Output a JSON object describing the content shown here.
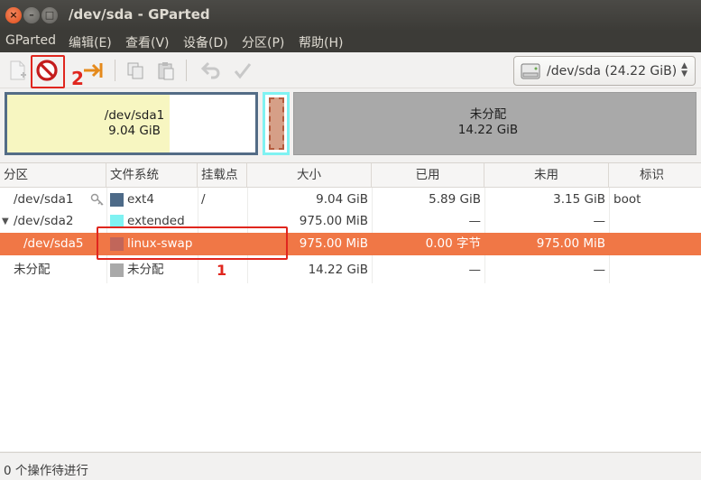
{
  "window": {
    "title": "/dev/sda - GParted"
  },
  "menu": [
    "GParted",
    "编辑(E)",
    "查看(V)",
    "设备(D)",
    "分区(P)",
    "帮助(H)"
  ],
  "toolbar": {
    "device_select": "/dev/sda  (24.22 GiB)",
    "annotation_toolbar": "2"
  },
  "diskmap": {
    "sda1": {
      "name": "/dev/sda1",
      "size": "9.04 GiB"
    },
    "unallocated": {
      "name": "未分配",
      "size": "14.22 GiB"
    }
  },
  "table": {
    "headers": [
      "分区",
      "文件系统",
      "挂载点",
      "大小",
      "已用",
      "未用",
      "标识"
    ],
    "rows": [
      {
        "partition": "/dev/sda1",
        "fs": "ext4",
        "mount": "/",
        "size": "9.04 GiB",
        "used": "5.89 GiB",
        "unused": "3.15 GiB",
        "flags": "boot"
      },
      {
        "partition": "/dev/sda2",
        "fs": "extended",
        "mount": "",
        "size": "975.00 MiB",
        "used": "—",
        "unused": "—",
        "flags": ""
      },
      {
        "partition": "/dev/sda5",
        "fs": "linux-swap",
        "mount": "",
        "size": "975.00 MiB",
        "used": "0.00 字节",
        "unused": "975.00 MiB",
        "flags": ""
      },
      {
        "partition": "未分配",
        "fs": "未分配",
        "mount": "",
        "size": "14.22 GiB",
        "used": "—",
        "unused": "—",
        "flags": ""
      }
    ],
    "annotation_row": "1"
  },
  "colors": {
    "ext4": "#4d6a88",
    "extended": "#7ff2f2",
    "linux_swap": "#c1665a",
    "unallocated": "#a9a9a9",
    "selection": "#f07746",
    "annotation": "#e0261e"
  },
  "status": {
    "text": "0 个操作待进行"
  }
}
